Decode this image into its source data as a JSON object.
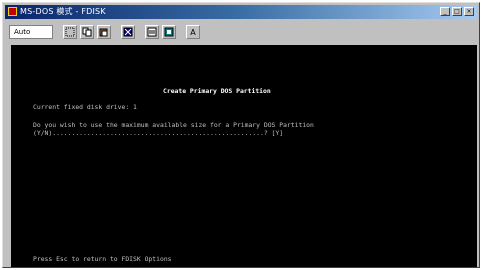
{
  "window": {
    "title": "MS-DOS 模式 - FDISK",
    "buttons": {
      "minimize": "_",
      "maximize": "□",
      "close": "×"
    }
  },
  "toolbar": {
    "font_value": "Auto",
    "buttons": [
      "mark-icon",
      "copy-icon",
      "paste-icon",
      "fullscreen-icon",
      "properties-icon",
      "background-icon",
      "font-icon"
    ],
    "font_button_label": "A"
  },
  "console": {
    "heading": "Create Primary DOS Partition",
    "current_drive": "Current fixed disk drive: 1",
    "question_line1": "Do you wish to use the maximum available size for a Primary DOS Partition",
    "question_line2": "(Y/N).......................................................? [Y]",
    "footer": "Press Esc to return to FDISK Options"
  }
}
